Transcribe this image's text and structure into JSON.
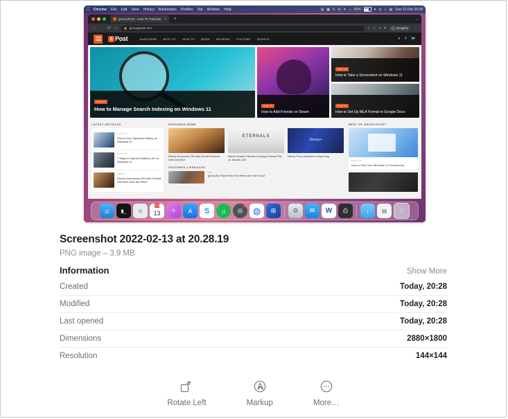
{
  "preview": {
    "menubar": {
      "apple_icon": "apple-logo-icon",
      "items": [
        "Chrome",
        "File",
        "Edit",
        "View",
        "History",
        "Bookmarks",
        "Profiles",
        "Tab",
        "Window",
        "Help"
      ],
      "status_icons": [
        "dropbox-icon",
        "screen-icon",
        "skype-icon",
        "bartender-icon",
        "bluetooth-icon",
        "control-center-icon"
      ],
      "battery_percent": "62%",
      "extra_status_icons": [
        "wifi-icon",
        "clock-icon",
        "spotlight-search-icon",
        "control-center-icon"
      ],
      "clock": "Sun 13 Feb  20:28"
    },
    "browser": {
      "traffic_lights": [
        "close-button",
        "minimize-button",
        "zoom-button"
      ],
      "tab": {
        "favicon": "groovypost-favicon",
        "title": "groovyPost - How-To Tutorials",
        "close": "×"
      },
      "new_tab": "+",
      "window_chevron": "⌄",
      "nav": {
        "back": "←",
        "forward": "→",
        "reload": "⟳",
        "home": "⌂"
      },
      "url": "groovypost.com",
      "lock_icon": "lock-icon",
      "toolbar_icons": [
        "zoom-icon",
        "bookmark-star-icon",
        "extension-blue-icon",
        "extension-icon"
      ],
      "profile": "Incognito",
      "menu_icon": "kebab-menu-icon"
    },
    "site": {
      "logo": {
        "mark": "g",
        "text": "Post"
      },
      "nav_links": [
        "SUBSCRIBE",
        "BEST OF",
        "HOW TO",
        "NEWS",
        "REVIEWS",
        "YOUTUBE",
        "SEARCH"
      ],
      "nav_right_icons": [
        "search-icon",
        "facebook-icon",
        "twitter-icon"
      ],
      "hero": {
        "main": {
          "badge": "HOW TO",
          "title": "How to Manage Search Indexing on Windows 11"
        },
        "mid": {
          "badge": "HOW TO",
          "title": "How to Add Friends on Steam"
        },
        "right_top": {
          "badge": "HOW TO",
          "title": "How to Take a Screenshot on Windows 11"
        },
        "right_bottom": {
          "badge": "HOW TO",
          "title": "How to Set Up MLA Format in Google Docs"
        }
      },
      "sections": {
        "latest": {
          "heading": "LATEST ARTICLES",
          "items": [
            {
              "meta": "HOW TO",
              "title": "How to Use Clipboard History on Windows 11"
            },
            {
              "meta": "HOW TO",
              "title": "7 Ways to Improve Battery Life on Windows 11"
            },
            {
              "meta": "NEWS",
              "title": "Disney Announces Obi-Wan Kenobi Premiere Date and More"
            }
          ]
        },
        "featured_news": {
          "heading": "FEATURED NEWS",
          "items": [
            {
              "title": "Disney Announces Obi-Wan Kenobi Premiere Date and More"
            },
            {
              "title": "Marvel Studios' Eternals Coming to Disney Plus on January 12th"
            },
            {
              "title": "Disney Plus Launches in Hong Kong"
            }
          ]
        },
        "lifehacks": {
          "heading": "FEATURED LIFEHACKS",
          "item": {
            "meta": "TIPS",
            "title": "groovyTip: Flood Here Find Where Are You're Dad"
          }
        },
        "best_of": {
          "heading": "BEST OF GROOVYPOST",
          "items": [
            {
              "meta": "HOW TO",
              "title": "How to Find Your Windows 11 Product Key"
            }
          ]
        }
      }
    },
    "dock": {
      "items": [
        {
          "name": "finder-icon",
          "glyph": "☺",
          "bg": "#2f9bea"
        },
        {
          "name": "terminal-icon",
          "glyph": "▮",
          "bg": "#1b1b1b"
        },
        {
          "name": "launchpad-icon",
          "glyph": "⦂",
          "bg": "#f0f0f2"
        },
        {
          "name": "calendar-icon",
          "glyph": "",
          "bg": "#ffffff",
          "month": "FEB",
          "day": "13"
        },
        {
          "name": "affinity-photo-icon",
          "glyph": "✧",
          "bg": "#d96be0"
        },
        {
          "name": "app-store-icon",
          "glyph": "A",
          "bg": "#1f8ff5"
        },
        {
          "name": "setapp-icon",
          "glyph": "S",
          "bg": "#1a9ae0"
        },
        {
          "name": "spotify-icon",
          "glyph": "♫",
          "bg": "#1db954"
        },
        {
          "name": "hey-mail-icon",
          "glyph": "◎",
          "bg": "#4c5356",
          "badge": "1"
        },
        {
          "name": "google-chrome-icon",
          "glyph": "◍",
          "bg": "#f2f2f2"
        },
        {
          "name": "parallels-windows-icon",
          "glyph": "⊞",
          "bg": "#2a5bd7"
        },
        {
          "name": "system-preferences-icon",
          "glyph": "⚙",
          "bg": "#c9ced6"
        },
        {
          "name": "mail-icon",
          "glyph": "✉",
          "bg": "#1f9bf0"
        },
        {
          "name": "microsoft-word-icon",
          "glyph": "W",
          "bg": "#2b579a"
        },
        {
          "name": "printer-icon",
          "glyph": "⎙",
          "bg": "#3a3a3c"
        },
        {
          "name": "downloads-folder-icon",
          "glyph": "↓",
          "bg": "#4eb3f0"
        },
        {
          "name": "documents-stack-icon",
          "glyph": "▤",
          "bg": "#eef0f2"
        },
        {
          "name": "trash-icon",
          "glyph": "🗑",
          "bg": "transparent"
        }
      ]
    }
  },
  "detail": {
    "file_name": "Screenshot 2022-02-13 at 20.28.19",
    "file_kind": "PNG image – 3.9 MB",
    "information_label": "Information",
    "show_more": "Show More",
    "rows": [
      {
        "key": "Created",
        "value": "Today, 20:28"
      },
      {
        "key": "Modified",
        "value": "Today, 20:28"
      },
      {
        "key": "Last opened",
        "value": "Today, 20:28"
      },
      {
        "key": "Dimensions",
        "value": "2880×1800"
      },
      {
        "key": "Resolution",
        "value": "144×144"
      }
    ]
  },
  "actions": [
    {
      "icon": "rotate-left-icon",
      "label": "Rotate Left"
    },
    {
      "icon": "markup-icon",
      "label": "Markup"
    },
    {
      "icon": "more-icon",
      "label": "More…"
    }
  ]
}
